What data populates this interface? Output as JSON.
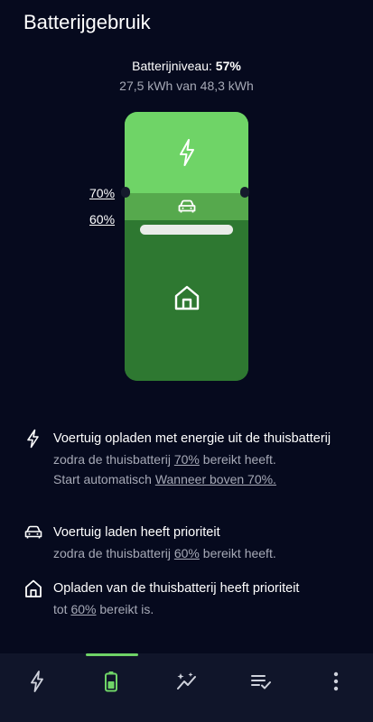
{
  "header": {
    "title": "Batterijgebruik"
  },
  "battery": {
    "level_label": "Batterijniveau: ",
    "level_value": "57%",
    "level_fraction": 0.57,
    "energy_text": "27,5 kWh van 48,3 kWh",
    "upper_threshold": "70%",
    "lower_threshold": "60%",
    "colors": {
      "top_segment": "#6fd467",
      "middle_segment": "#56a94d",
      "bottom_segment": "#2e7831",
      "level_bar": "#e9ece8"
    }
  },
  "info": {
    "items": [
      {
        "icon": "bolt-icon",
        "title": "Voertuig opladen met energie uit de thuisbatterij",
        "sub1_prefix": "zodra de thuisbatterij ",
        "sub1_value": "70%",
        "sub1_suffix": " bereikt heeft.",
        "sub2_prefix": "Start automatisch ",
        "sub2_link": "Wanneer boven 70%."
      },
      {
        "icon": "car-icon",
        "title": "Voertuig laden heeft prioriteit",
        "sub1_prefix": "zodra de thuisbatterij ",
        "sub1_value": "60%",
        "sub1_suffix": " bereikt heeft."
      },
      {
        "icon": "house-icon",
        "title": "Opladen van de thuisbatterij heeft prioriteit",
        "sub1_prefix": "tot ",
        "sub1_value": "60%",
        "sub1_suffix": " bereikt is."
      }
    ]
  },
  "nav": {
    "active_index": 1,
    "active_color": "#6fd467",
    "items": [
      "bolt-icon",
      "battery-icon",
      "sparkle-chart-icon",
      "list-check-icon",
      "more-vertical-icon"
    ]
  }
}
